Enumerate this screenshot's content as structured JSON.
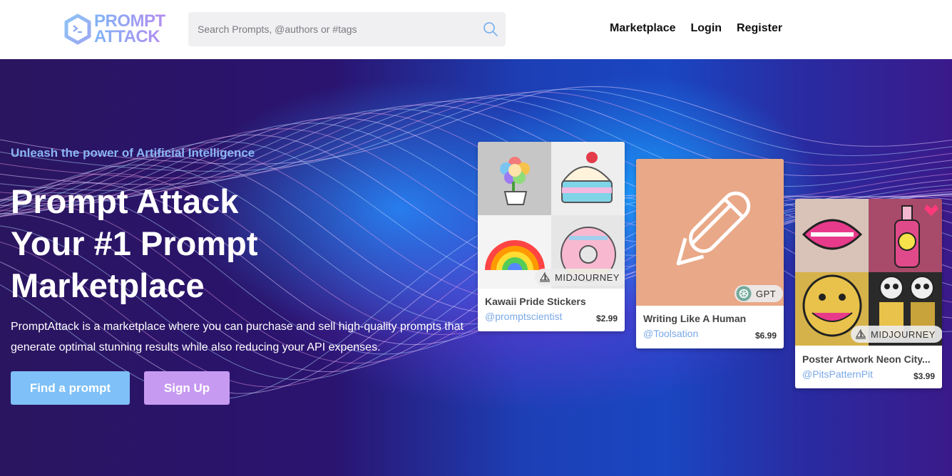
{
  "header": {
    "logo": {
      "line1": "PROMPT",
      "line2": "ATTACK",
      "icon": "terminal-hex-icon"
    },
    "search": {
      "placeholder": "Search Prompts, @authors or #tags",
      "icon": "search-icon"
    },
    "nav": [
      "Marketplace",
      "Login",
      "Register"
    ]
  },
  "hero": {
    "tagline": "Unleash the power of Artificial Intelligence",
    "headline": [
      "Prompt Attack",
      "Your #1 Prompt",
      "Marketplace"
    ],
    "description": "PromptAttack is a marketplace where you can purchase and sell high-quality prompts that generate optimal stunning results while also reducing your API expenses.",
    "buttons": {
      "find": "Find a prompt",
      "signup": "Sign Up"
    }
  },
  "cards": [
    {
      "title": "Kawaii Pride Stickers",
      "author": "@promptscientist",
      "price": "$2.99",
      "badge": "MIDJOURNEY",
      "badge_icon": "sailboat-icon"
    },
    {
      "title": "Writing Like A Human",
      "author": "@Toolsation",
      "price": "$6.99",
      "badge": "GPT",
      "badge_icon": "openai-icon",
      "image_icon": "pencil-icon"
    },
    {
      "title": "Poster Artwork Neon City...",
      "author": "@PitsPatternPit",
      "price": "$3.99",
      "badge": "MIDJOURNEY",
      "badge_icon": "sailboat-icon"
    }
  ],
  "colors": {
    "accent_blue": "#7ec0f7",
    "accent_purple": "#c79af2",
    "tagline": "#8bb6f5",
    "author_link": "#7aa8e6",
    "card2_bg": "#e9a887"
  }
}
